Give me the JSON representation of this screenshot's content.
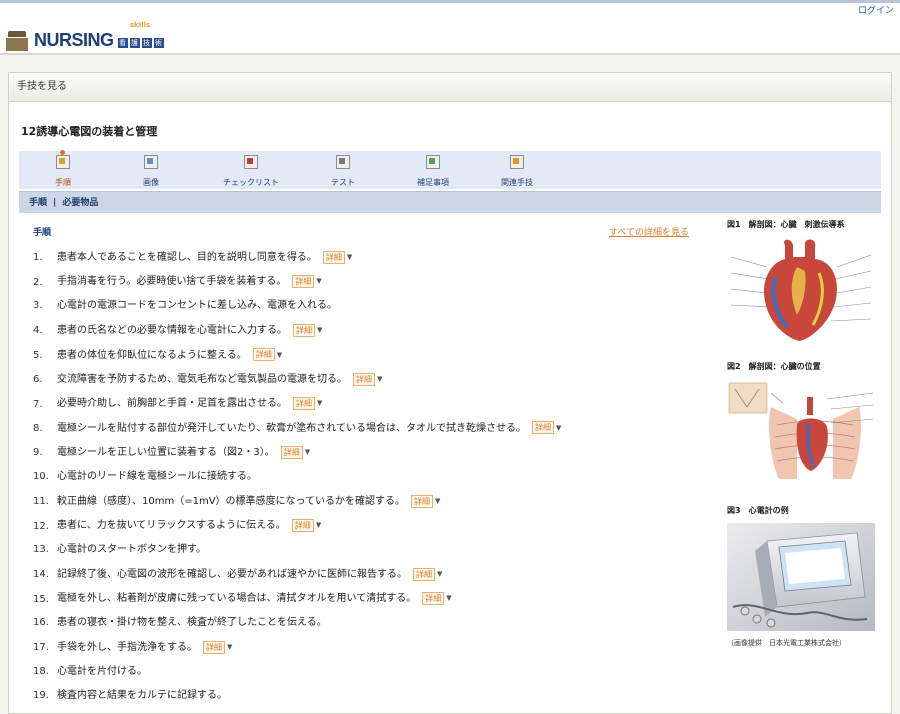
{
  "header": {
    "logo_text": "NURSING",
    "logo_tag": [
      "看",
      "護",
      "技",
      "術"
    ],
    "logo_sup": "skills",
    "login": "ログイン"
  },
  "panel": {
    "title": "手技を見る",
    "page_title": "12誘導心電図の装着と管理"
  },
  "tabs": [
    {
      "label": "手順",
      "active": true
    },
    {
      "label": "画像",
      "active": false
    },
    {
      "label": "チェックリスト",
      "active": false
    },
    {
      "label": "テスト",
      "active": false
    },
    {
      "label": "補足事項",
      "active": false
    },
    {
      "label": "関連手技",
      "active": false
    }
  ],
  "breadcrumb": {
    "a": "手順",
    "sep": "|",
    "b": "必要物品"
  },
  "section": {
    "heading": "手順",
    "see_all": "すべての詳細を見る"
  },
  "detail_label": "詳細",
  "steps": [
    {
      "num": "1.",
      "text": "患者本人であることを確認し、目的を説明し同意を得る。",
      "detail": true
    },
    {
      "num": "2.",
      "text": "手指消毒を行う。必要時使い捨て手袋を装着する。",
      "detail": true
    },
    {
      "num": "3.",
      "text": "心電計の電源コードをコンセントに差し込み、電源を入れる。",
      "detail": false
    },
    {
      "num": "4.",
      "text": "患者の氏名などの必要な情報を心電計に入力する。",
      "detail": true
    },
    {
      "num": "5.",
      "text": "患者の体位を仰臥位になるように整える。",
      "detail": true
    },
    {
      "num": "6.",
      "text": "交流障害を予防するため、電気毛布など電気製品の電源を切る。",
      "detail": true
    },
    {
      "num": "7.",
      "text": "必要時介助し、前胸部と手首・足首を露出させる。",
      "detail": true
    },
    {
      "num": "8.",
      "text": "電極シールを貼付する部位が発汗していたり、軟膏が塗布されている場合は、タオルで拭き乾燥させる。",
      "detail": true
    },
    {
      "num": "9.",
      "text": "電極シールを正しい位置に装着する（図2・3）。",
      "detail": true
    },
    {
      "num": "10.",
      "text": "心電計のリード線を電極シールに接続する。",
      "detail": false
    },
    {
      "num": "11.",
      "text": "較正曲線（感度）、10mm（=1mV）の標準感度になっているかを確認する。",
      "detail": true
    },
    {
      "num": "12.",
      "text": "患者に、力を抜いてリラックスするように伝える。",
      "detail": true
    },
    {
      "num": "13.",
      "text": "心電計のスタートボタンを押す。",
      "detail": false
    },
    {
      "num": "14.",
      "text": "記録終了後、心電図の波形を確認し、必要があれば速やかに医師に報告する。",
      "detail": true
    },
    {
      "num": "15.",
      "text": "電極を外し、粘着剤が皮膚に残っている場合は、清拭タオルを用いて清拭する。",
      "detail": true
    },
    {
      "num": "16.",
      "text": "患者の寝衣・掛け物を整え、検査が終了したことを伝える。",
      "detail": false
    },
    {
      "num": "17.",
      "text": "手袋を外し、手指洗浄をする。",
      "detail": true
    },
    {
      "num": "18.",
      "text": "心電計を片付ける。",
      "detail": false
    },
    {
      "num": "19.",
      "text": "検査内容と結果をカルテに記録する。",
      "detail": false
    }
  ],
  "figures": [
    {
      "caption": "図1　解剖図：心臓　刺激伝導系"
    },
    {
      "caption": "図2　解剖図：心臓の位置"
    },
    {
      "caption": "図3　心電計の例",
      "credit": "（画像提供　日本光電工業株式会社）"
    }
  ],
  "colors": {
    "accent_orange": "#d9822b",
    "nav_blue": "#1f3d7a",
    "tab_bg": "#e3eaf5"
  }
}
